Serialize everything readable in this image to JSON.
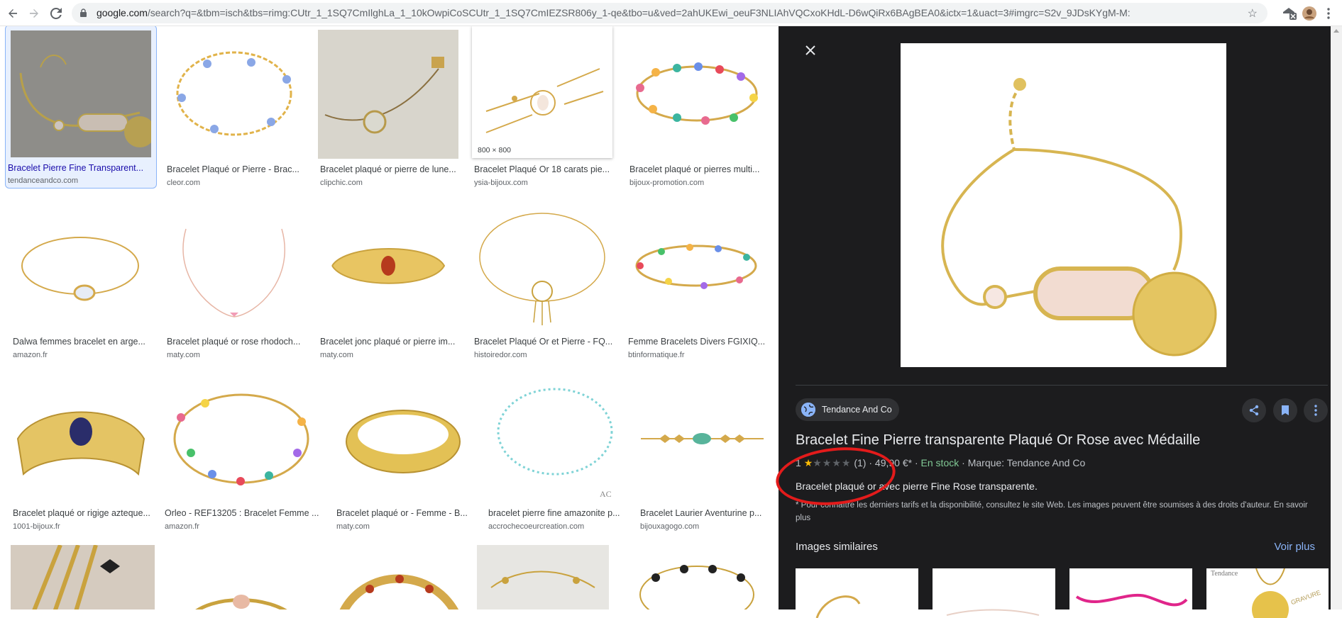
{
  "browser": {
    "url_host": "google.com",
    "url_rest": "/search?q=&tbm=isch&tbs=rimg:CUtr_1_1SQ7CmIlghLa_1_10kOwpiCoSCUtr_1_1SQ7CmIEZSR806y_1-qe&tbo=u&ved=2ahUKEwi_oeuF3NLIAhVQCxoKHdL-D6wQiRx6BAgBEA0&ictx=1&uact=3#imgrc=S2v_9JDsKYgM-M:"
  },
  "grid": {
    "rows": [
      [
        {
          "caption": "Bracelet Pierre Fine Transparent...",
          "source": "tendanceandco.com",
          "selected": true
        },
        {
          "caption": "Bracelet Plaqué or Pierre - Brac...",
          "source": "cleor.com"
        },
        {
          "caption": "Bracelet plaqué or pierre de lune...",
          "source": "clipchic.com"
        },
        {
          "caption": "Bracelet Plaqué Or 18 carats pie...",
          "source": "ysia-bijoux.com",
          "badge": "800 × 800"
        },
        {
          "caption": "Bracelet plaqué or pierres multi...",
          "source": "bijoux-promotion.com"
        }
      ],
      [
        {
          "caption": "Dalwa femmes bracelet en arge...",
          "source": "amazon.fr"
        },
        {
          "caption": "Bracelet plaqué or rose rhodoch...",
          "source": "maty.com"
        },
        {
          "caption": "Bracelet jonc plaqué or pierre im...",
          "source": "maty.com"
        },
        {
          "caption": "Bracelet Plaqué Or et Pierre - FQ...",
          "source": "histoiredor.com"
        },
        {
          "caption": "Femme Bracelets Divers FGIXIQ...",
          "source": "btinformatique.fr"
        }
      ],
      [
        {
          "caption": "Bracelet plaqué or rigige azteque...",
          "source": "1001-bijoux.fr"
        },
        {
          "caption": "Orleo - REF13205 : Bracelet Femme ...",
          "source": "amazon.fr"
        },
        {
          "caption": "Bracelet plaqué or - Femme - B...",
          "source": "maty.com"
        },
        {
          "caption": "bracelet pierre fine amazonite p...",
          "source": "accrochecoeurcreation.com"
        },
        {
          "caption": "Bracelet Laurier Aventurine p...",
          "source": "bijouxagogo.com"
        }
      ]
    ]
  },
  "panel": {
    "source_name": "Tendance And Co",
    "title": "Bracelet Fine Pierre transparente Plaqué Or Rose avec Médaille",
    "rating_value": "1",
    "rating_count": "(1)",
    "price": "49,90 €*",
    "stock": "En stock",
    "brand": "Marque: Tendance And Co",
    "description": "Bracelet plaqué or avec pierre Fine Rose transparente.",
    "disclaimer": "* Pour connaître les derniers tarifs et la disponibilité, consultez le site Web. Les images peuvent être soumises à des droits d'auteur.",
    "disclaimer_more": "En savoir plus",
    "similar_heading": "Images similaires",
    "see_more": "Voir plus",
    "similar_thumb_text": [
      "Tendance",
      "GRAVURE"
    ]
  },
  "colors": {
    "panel_bg": "#1c1c1e",
    "accent_blue": "#8ab4f8",
    "in_stock_green": "#81c995",
    "star_gold": "#fbbc04",
    "annotation_red": "#e31b1b"
  },
  "icons": [
    "back-arrow-icon",
    "forward-arrow-icon",
    "reload-icon",
    "lock-icon",
    "bookmark-star-icon",
    "extension-icon",
    "profile-avatar",
    "menu-dots-icon",
    "close-icon",
    "share-icon",
    "bookmark-icon",
    "more-vert-icon",
    "globe-icon"
  ]
}
